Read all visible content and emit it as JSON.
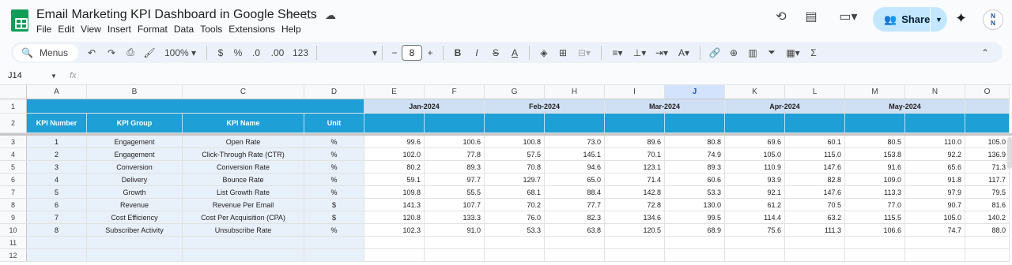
{
  "doc": {
    "title": "Email Marketing KPI Dashboard in Google Sheets",
    "menu": [
      "File",
      "Edit",
      "View",
      "Insert",
      "Format",
      "Data",
      "Tools",
      "Extensions",
      "Help"
    ]
  },
  "share": {
    "label": "Share"
  },
  "avatar": {
    "text": "N\nN"
  },
  "toolbar": {
    "menus_label": "Menus",
    "zoom": "100%",
    "currency": "$",
    "percent": "%",
    "dec_less": ".0",
    "dec_more": ".00",
    "number_format": "123",
    "font_size": "8"
  },
  "namebox": {
    "cell": "J14",
    "fx": "fx"
  },
  "columns": [
    "A",
    "B",
    "C",
    "D",
    "E",
    "F",
    "G",
    "H",
    "I",
    "J",
    "K",
    "L",
    "M",
    "N",
    "O"
  ],
  "selected_column": "J",
  "rows": [
    "1",
    "2",
    "3",
    "4",
    "5",
    "6",
    "7",
    "8",
    "9",
    "10",
    "11",
    "12"
  ],
  "headers": {
    "kpi_number": "KPI Number",
    "kpi_group": "KPI Group",
    "kpi_name": "KPI Name",
    "unit": "Unit"
  },
  "months": [
    "Jan-2024",
    "Feb-2024",
    "Mar-2024",
    "Apr-2024",
    "May-2024"
  ],
  "kpis": [
    {
      "num": "1",
      "group": "Engagement",
      "name": "Open Rate",
      "unit": "%",
      "values": [
        "99.6",
        "100.6",
        "100.8",
        "73.0",
        "89.6",
        "80.8",
        "69.6",
        "60.1",
        "80.5",
        "110.0",
        "105.0"
      ]
    },
    {
      "num": "2",
      "group": "Engagement",
      "name": "Click-Through Rate (CTR)",
      "unit": "%",
      "values": [
        "102.0",
        "77.8",
        "57.5",
        "145.1",
        "70.1",
        "74.9",
        "105.0",
        "115.0",
        "153.8",
        "92.2",
        "136.9"
      ]
    },
    {
      "num": "3",
      "group": "Conversion",
      "name": "Conversion Rate",
      "unit": "%",
      "values": [
        "80.2",
        "89.3",
        "70.8",
        "94.6",
        "123.1",
        "89.3",
        "110.9",
        "147.6",
        "91.6",
        "65.6",
        "71.3"
      ]
    },
    {
      "num": "4",
      "group": "Delivery",
      "name": "Bounce Rate",
      "unit": "%",
      "values": [
        "59.1",
        "97.7",
        "129.7",
        "65.0",
        "71.4",
        "60.6",
        "93.9",
        "82.8",
        "109.0",
        "91.8",
        "117.7"
      ]
    },
    {
      "num": "5",
      "group": "Growth",
      "name": "List Growth Rate",
      "unit": "%",
      "values": [
        "109.8",
        "55.5",
        "68.1",
        "88.4",
        "142.8",
        "53.3",
        "92.1",
        "147.6",
        "113.3",
        "97.9",
        "79.5"
      ]
    },
    {
      "num": "6",
      "group": "Revenue",
      "name": "Revenue Per Email",
      "unit": "$",
      "values": [
        "141.3",
        "107.7",
        "70.2",
        "77.7",
        "72.8",
        "130.0",
        "61.2",
        "70.5",
        "77.0",
        "90.7",
        "81.6"
      ]
    },
    {
      "num": "7",
      "group": "Cost Efficiency",
      "name": "Cost Per Acquisition (CPA)",
      "unit": "$",
      "values": [
        "120.8",
        "133.3",
        "76.0",
        "82.3",
        "134.6",
        "99.5",
        "114.4",
        "63.2",
        "115.5",
        "105.0",
        "140.2"
      ]
    },
    {
      "num": "8",
      "group": "Subscriber Activity",
      "name": "Unsubscribe Rate",
      "unit": "%",
      "values": [
        "102.3",
        "91.0",
        "53.3",
        "63.8",
        "120.5",
        "68.9",
        "75.6",
        "111.3",
        "106.6",
        "74.7",
        "88.0"
      ]
    }
  ]
}
